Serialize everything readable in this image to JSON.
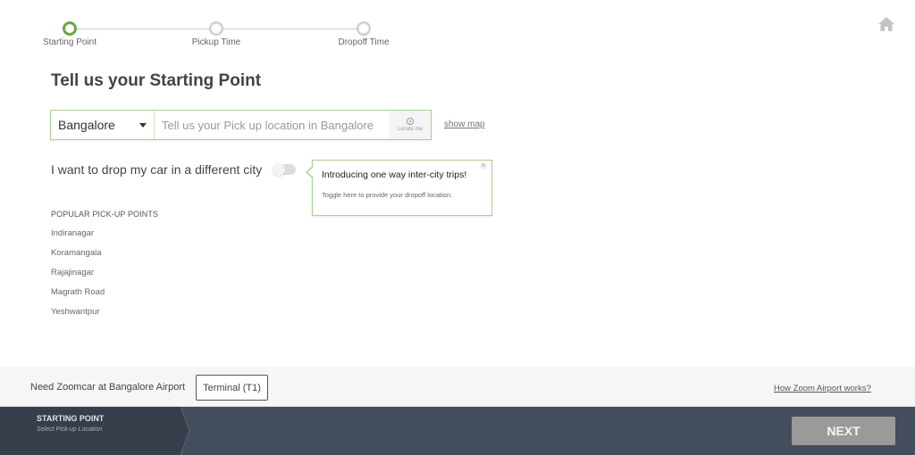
{
  "stepper": {
    "steps": [
      {
        "label": "Starting Point",
        "active": true
      },
      {
        "label": "Pickup Time",
        "active": false
      },
      {
        "label": "Dropoff Time",
        "active": false
      }
    ],
    "active_color": "#6aa744"
  },
  "header": {
    "home_icon": "home-icon"
  },
  "main": {
    "title": "Tell us your Starting Point",
    "city_select": {
      "value": "Bangalore"
    },
    "location_input": {
      "placeholder": "Tell us your Pick up location in Bangalore",
      "value": ""
    },
    "locate_label": "Locate me",
    "show_map_label": "show map",
    "drop_text": "I want to drop my car in a different city",
    "drop_toggle_on": false,
    "tooltip": {
      "title": "Introducing one way inter-city trips!",
      "body": "Toggle here to provide your dropoff location.",
      "close": "×"
    },
    "popular": {
      "heading": "POPULAR PICK-UP POINTS",
      "items": [
        "Indiranagar",
        "Koramangala",
        "Rajajinagar",
        "Magrath Road",
        "Yeshwantpur"
      ]
    }
  },
  "airport": {
    "text": "Need Zoomcar at Bangalore Airport",
    "terminal_label": "Terminal (T1)",
    "how_link": "How Zoom Airport works?"
  },
  "footer": {
    "crumb_title": "STARTING POINT",
    "crumb_subtitle": "Select Pick-up Location",
    "next_label": "NEXT"
  }
}
